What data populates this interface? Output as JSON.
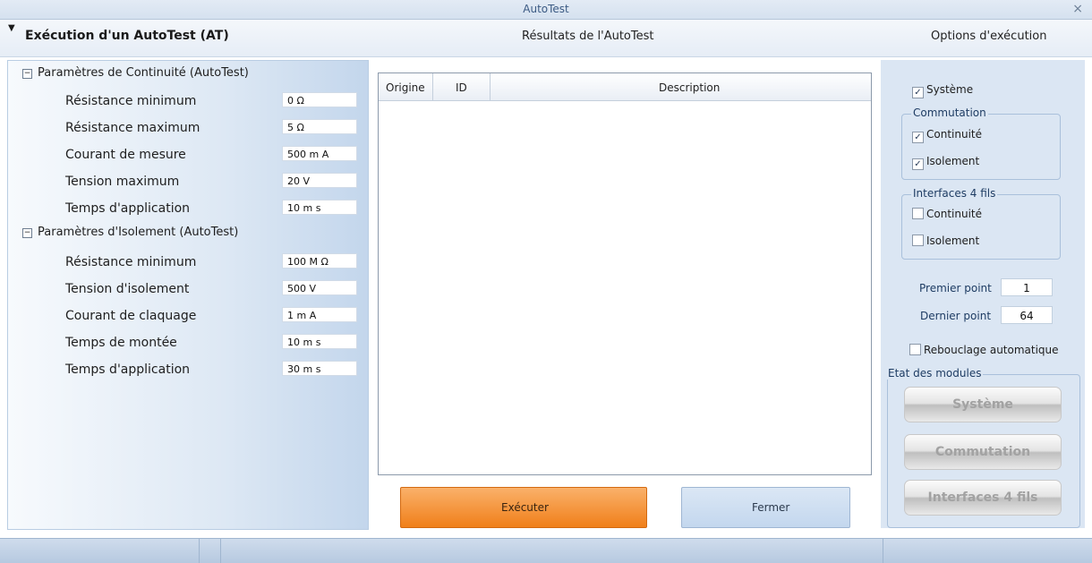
{
  "window": {
    "title": "AutoTest",
    "close_glyph": "×"
  },
  "header": {
    "left_title": "Exécution d'un AutoTest  (AT)",
    "middle_title": "Résultats de l'AutoTest",
    "right_title": "Options d'exécution"
  },
  "continuity": {
    "title": "Paramètres de Continuité (AutoTest)",
    "params": [
      {
        "label": "Résistance minimum",
        "value": "0  Ω"
      },
      {
        "label": "Résistance maximum",
        "value": "5  Ω"
      },
      {
        "label": "Courant de mesure",
        "value": "500 m A"
      },
      {
        "label": "Tension maximum",
        "value": "20  V"
      },
      {
        "label": "Temps d'application",
        "value": "10 m s"
      }
    ]
  },
  "insulation": {
    "title": "Paramètres d'Isolement (AutoTest)",
    "params": [
      {
        "label": "Résistance minimum",
        "value": "100 M Ω"
      },
      {
        "label": "Tension d'isolement",
        "value": "500  V"
      },
      {
        "label": "Courant de claquage",
        "value": "1 m A"
      },
      {
        "label": "Temps de montée",
        "value": "10 m s"
      },
      {
        "label": "Temps d'application",
        "value": "30 m s"
      }
    ]
  },
  "results_table": {
    "columns": [
      "Origine",
      "ID",
      "Description"
    ],
    "rows": []
  },
  "buttons": {
    "execute": "Exécuter",
    "close": "Fermer"
  },
  "options": {
    "system": {
      "label": "Système",
      "checked": true
    },
    "commutation": {
      "legend": "Commutation",
      "continuity": {
        "label": "Continuité",
        "checked": true
      },
      "isolation": {
        "label": "Isolement",
        "checked": true
      }
    },
    "interfaces": {
      "legend": "Interfaces 4 fils",
      "continuity": {
        "label": "Continuité",
        "checked": false
      },
      "isolation": {
        "label": "Isolement",
        "checked": false
      }
    },
    "first_point": {
      "label": "Premier point",
      "value": "1"
    },
    "last_point": {
      "label": "Dernier point",
      "value": "64"
    },
    "auto_loopback": {
      "label": "Rebouclage automatique",
      "checked": false
    },
    "modules": {
      "legend": "Etat des modules",
      "system": "Système",
      "commutation": "Commutation",
      "interfaces": "Interfaces 4 fils"
    }
  },
  "colors": {
    "accent": "#f07f1a",
    "panel": "#dbe6f3",
    "header_text": "#1e3c63"
  }
}
